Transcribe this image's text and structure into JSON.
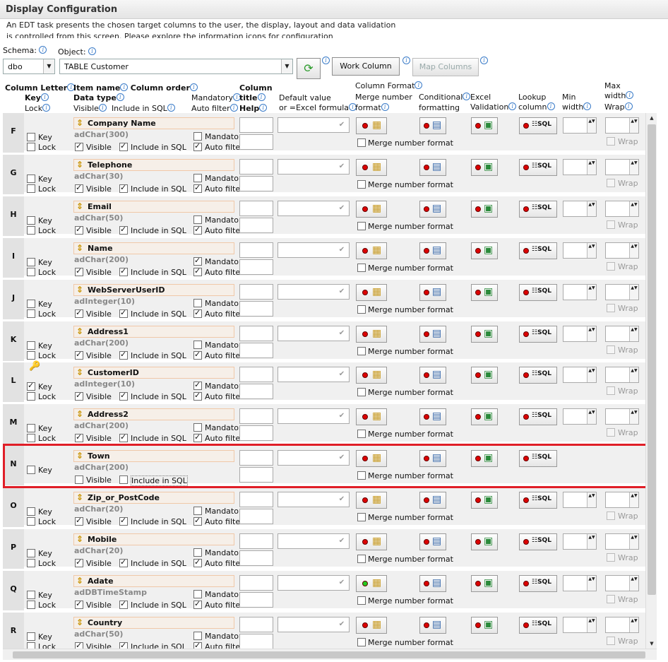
{
  "header": {
    "title": "Display Configuration",
    "description": "An EDT task presents the chosen target columns to the user, the display, layout and data validation is controlled from this screen.  Please explore the information icons for configuration"
  },
  "toolbar": {
    "schema_label": "Schema:",
    "schema_value": "dbo",
    "object_label": "Object:",
    "object_value": "TABLE Customer",
    "work_column": "Work Column",
    "map_columns": "Map Columns"
  },
  "columns": {
    "column_letter": "Column Letter",
    "key": "Key",
    "lock": "Lock",
    "item_name": "Item name",
    "column_order": "Column order",
    "data_type": "Data type",
    "visible": "Visible",
    "include_in_sql": "Include in SQL",
    "mandatory": "Mandatory",
    "auto_filter": "Auto filter",
    "column": "Column",
    "title": "title",
    "help": "Help",
    "default_value": "Default value",
    "excel_formula": "or =Excel formula",
    "column_format": "Column Format",
    "merge_number": "Merge number",
    "format": "format",
    "conditional": "Conditional",
    "formatting": "formatting",
    "excel": "Excel",
    "validation": "Validation",
    "lookup": "Lookup",
    "lookup_column": "column",
    "min": "Min",
    "min_width": "width",
    "max": "Max",
    "max_width": "width",
    "wrap": "Wrap"
  },
  "row_labels": {
    "key": "Key",
    "lock": "Lock",
    "visible": "Visible",
    "include": "Include in SQL",
    "mandatory": "Mandato",
    "mandatory_alt": "Mandator",
    "auto": "Auto filte",
    "merge": "Merge number format",
    "wrap": "Wrap"
  },
  "rows": [
    {
      "letter": "F",
      "name": "Company Name",
      "type": "adChar(300)"
    },
    {
      "letter": "G",
      "name": "Telephone",
      "type": "adChar(30)"
    },
    {
      "letter": "H",
      "name": "Email",
      "type": "adChar(50)"
    },
    {
      "letter": "I",
      "name": "Name",
      "type": "adChar(200)"
    },
    {
      "letter": "J",
      "name": "WebServerUserID",
      "type": "adInteger(10)"
    },
    {
      "letter": "K",
      "name": "Address1",
      "type": "adChar(200)"
    },
    {
      "letter": "L",
      "name": "CustomerID",
      "type": "adInteger(10)"
    },
    {
      "letter": "M",
      "name": "Address2",
      "type": "adChar(200)"
    },
    {
      "letter": "N",
      "name": "Town",
      "type": "adChar(200)"
    },
    {
      "letter": "O",
      "name": "Zip_or_PostCode",
      "type": "adChar(20)"
    },
    {
      "letter": "P",
      "name": "Mobile",
      "type": "adChar(20)"
    },
    {
      "letter": "Q",
      "name": "Adate",
      "type": "adDBTimeStamp"
    },
    {
      "letter": "R",
      "name": "Country",
      "type": "adChar(50)"
    }
  ],
  "colors": {
    "highlight": "#e01e27",
    "item_bg": "#f6efe8",
    "row_bg": "#f0f0f0"
  }
}
